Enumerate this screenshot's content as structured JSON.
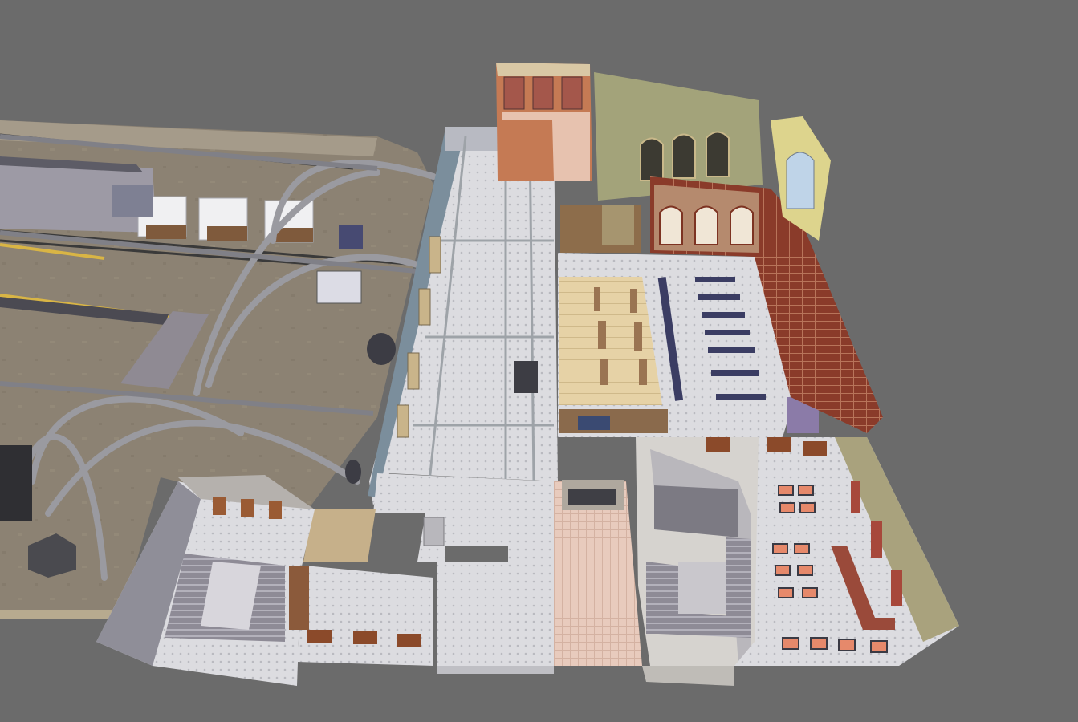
{
  "viewport": {
    "background": "#6b6b6b",
    "mode": "3d-overhead-perspective"
  },
  "scene": {
    "subject": "train-station-3d-model",
    "zones": [
      {
        "id": "platforms",
        "floor_color": "#8c8273"
      },
      {
        "id": "concourse-walkway",
        "floor_color": "#d9d9dc"
      },
      {
        "id": "main-hall",
        "floor_color": "#dedee2"
      },
      {
        "id": "ticket-hall",
        "floor_color": "#e6d2a6"
      },
      {
        "id": "cafe",
        "floor_color": "#e4e4e8"
      },
      {
        "id": "stair-hall-left",
        "floor_color": "#dcdce0"
      },
      {
        "id": "stair-hall-right",
        "floor_color": "#d6d3cf"
      },
      {
        "id": "pink-corridor",
        "floor_color": "#e8cbbd"
      },
      {
        "id": "gallery-hall",
        "floor_color": "#d8d8dc"
      },
      {
        "id": "facade-rear",
        "floor_color": "#c9b88a"
      }
    ],
    "accent_colors": {
      "brick": "#8a3b2a",
      "facade_green": "#a3a37a",
      "iron_arches": "#9a9aa0",
      "bench_navy": "#3b3d63",
      "track_rail": "#3a3a3a",
      "platform_yellow": "#d9b545"
    }
  }
}
